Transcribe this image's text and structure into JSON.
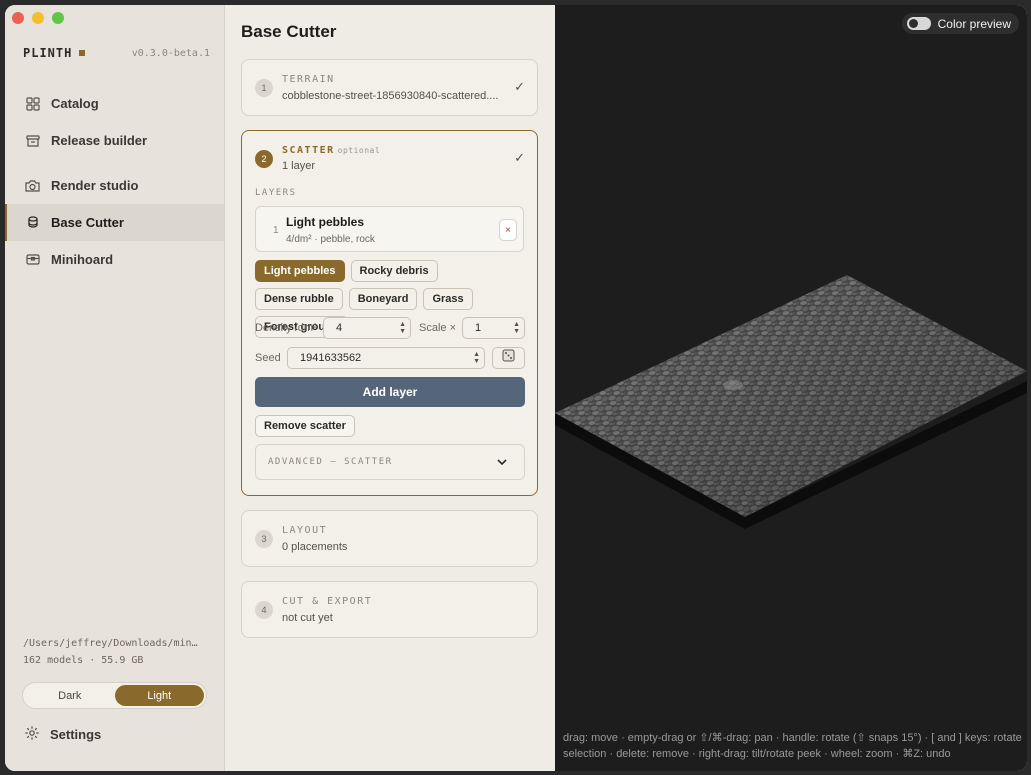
{
  "sidebar": {
    "brand": "PLINTH",
    "version": "v0.3.0-beta.1",
    "items": [
      {
        "label": "Catalog",
        "icon": "grid-icon"
      },
      {
        "label": "Release builder",
        "icon": "archive-box-icon"
      },
      {
        "label": "Render studio",
        "icon": "camera-icon"
      },
      {
        "label": "Base Cutter",
        "icon": "cylinder-icon",
        "active": true
      },
      {
        "label": "Minihoard",
        "icon": "chest-icon"
      }
    ],
    "path": "/Users/jeffrey/Downloads/min…",
    "stats": "162 models · 55.9 GB",
    "theme": {
      "dark": "Dark",
      "light": "Light",
      "selected": "Light"
    },
    "settings": "Settings"
  },
  "main": {
    "title": "Base Cutter",
    "steps": [
      {
        "num": "1",
        "title": "TERRAIN",
        "sub": "cobblestone-street-1856930840-scattered....",
        "done": true
      },
      {
        "num": "2",
        "title": "SCATTER",
        "optional": "optional",
        "sub": "1 layer",
        "done": true
      },
      {
        "num": "3",
        "title": "LAYOUT",
        "sub": "0 placements"
      },
      {
        "num": "4",
        "title": "CUT & EXPORT",
        "sub": "not cut yet"
      }
    ],
    "scatter": {
      "layers_label": "LAYERS",
      "layer": {
        "index": "1",
        "name": "Light pebbles",
        "meta": "4/dm² · pebble, rock",
        "remove": "×"
      },
      "presets": [
        "Light pebbles",
        "Rocky debris",
        "Dense rubble",
        "Boneyard",
        "Grass",
        "Forest ground"
      ],
      "selected_preset": "Light pebbles",
      "density_label": "Density /dm²",
      "density_value": "4",
      "scale_label": "Scale ×",
      "scale_value": "1",
      "seed_label": "Seed",
      "seed_value": "1941633562",
      "add_layer": "Add layer",
      "remove_scatter": "Remove scatter",
      "advanced": "ADVANCED — SCATTER"
    }
  },
  "viewport": {
    "color_preview": "Color preview",
    "color_preview_on": true,
    "hint": "drag: move · empty-drag or ⇧/⌘-drag: pan · handle: rotate (⇧ snaps 15°) · [ and ] keys: rotate selection · delete: remove · right-drag: tilt/rotate peek · wheel: zoom · ⌘Z: undo"
  },
  "colors": {
    "accent": "#8a6a2c",
    "button": "#56667a",
    "viewport_bg": "#1d1d1d"
  }
}
